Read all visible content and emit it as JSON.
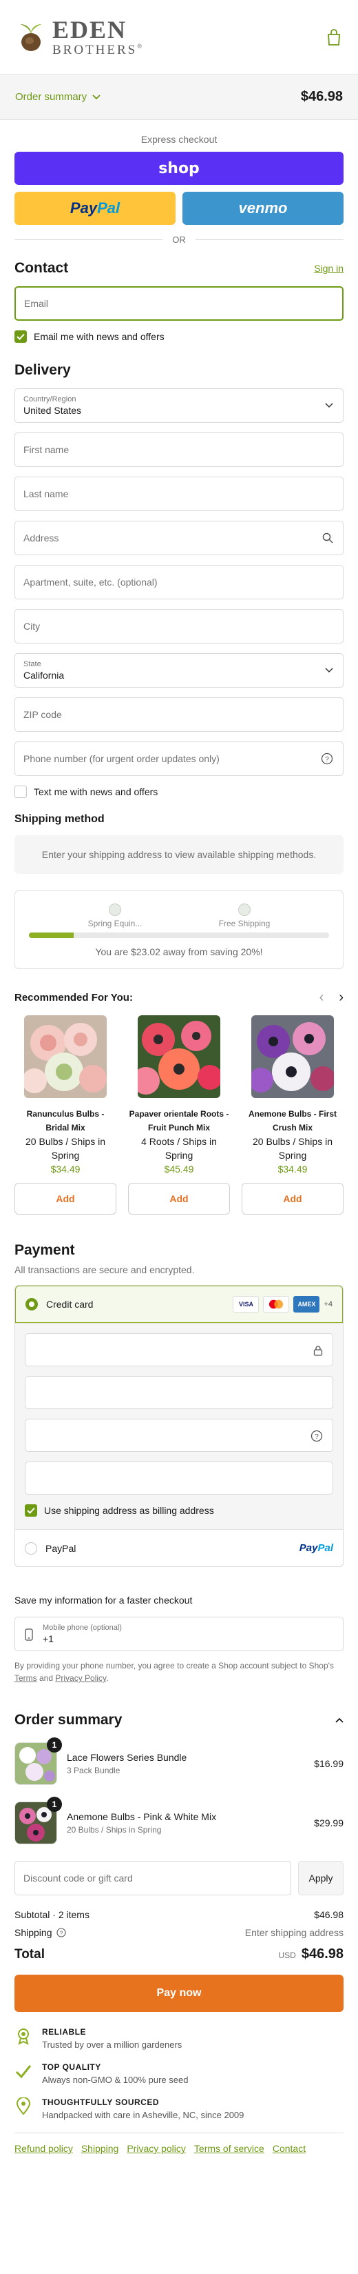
{
  "brand": {
    "line1": "EDEN",
    "line2": "BROTHERS",
    "mark": "®"
  },
  "summary_bar": {
    "toggle_label": "Order summary",
    "total": "$46.98"
  },
  "express": {
    "title": "Express checkout",
    "shop_label": "shop",
    "paypal_a": "Pay",
    "paypal_b": "Pal",
    "venmo_label": "venmo",
    "or_label": "OR"
  },
  "contact": {
    "heading": "Contact",
    "sign_in": "Sign in",
    "email_placeholder": "Email",
    "news_label": "Email me with news and offers",
    "news_checked": true
  },
  "delivery": {
    "heading": "Delivery",
    "country_label": "Country/Region",
    "country_value": "United States",
    "first_name": "First name",
    "last_name": "Last name",
    "address": "Address",
    "apartment": "Apartment, suite, etc. (optional)",
    "city": "City",
    "state_label": "State",
    "state_value": "California",
    "zip": "ZIP code",
    "phone": "Phone number (for urgent order updates only)",
    "sms_label": "Text me with news and offers"
  },
  "shipping_method": {
    "heading": "Shipping method",
    "note": "Enter your shipping address to view available shipping methods."
  },
  "progress": {
    "mark1": "Spring Equin...",
    "mark2": "Free Shipping",
    "fill_fraction": 0.15,
    "message": "You are $23.02 away from saving 20%!"
  },
  "recommended": {
    "heading": "Recommended For You:",
    "prev": "‹",
    "next": "›",
    "add_label": "Add",
    "items": [
      {
        "name": "Ranunculus Bulbs - Bridal Mix",
        "desc": "20 Bulbs / Ships in Spring",
        "price": "$34.49"
      },
      {
        "name": "Papaver orientale Roots - Fruit Punch Mix",
        "desc": "4 Roots / Ships in Spring",
        "price": "$45.49"
      },
      {
        "name": "Anemone Bulbs - First Crush Mix",
        "desc": "20 Bulbs / Ships in Spring",
        "price": "$34.49"
      }
    ]
  },
  "payment": {
    "heading": "Payment",
    "subtitle": "All transactions are secure and encrypted.",
    "credit_card": "Credit card",
    "card_visa": "VISA",
    "card_amex": "AMEX",
    "more_cards": "+4",
    "billing_label": "Use shipping address as billing address",
    "paypal_option": "PayPal",
    "paypal_logo_a": "Pay",
    "paypal_logo_b": "Pal"
  },
  "save_info": {
    "title": "Save my information for a faster checkout",
    "phone_label": "Mobile phone (optional)",
    "phone_value": "+1",
    "legal_a": "By providing your phone number, you agree to create a Shop account subject to Shop's ",
    "terms": "Terms",
    "legal_b": " and ",
    "privacy": "Privacy Policy",
    "legal_c": "."
  },
  "order_summary": {
    "heading": "Order summary",
    "items": [
      {
        "qty": "1",
        "title": "Lace Flowers Series Bundle",
        "sub": "3 Pack Bundle",
        "price": "$16.99"
      },
      {
        "qty": "1",
        "title": "Anemone Bulbs - Pink & White Mix",
        "sub": "20 Bulbs / Ships in Spring",
        "price": "$29.99"
      }
    ],
    "discount_placeholder": "Discount code or gift card",
    "apply": "Apply",
    "subtotal_label": "Subtotal · 2 items",
    "subtotal_value": "$46.98",
    "shipping_label": "Shipping",
    "shipping_value": "Enter shipping address",
    "total_label": "Total",
    "currency": "USD",
    "total_value": "$46.98",
    "pay_now": "Pay now"
  },
  "trust": [
    {
      "icon": "ribbon-award-icon",
      "title": "RELIABLE",
      "text": "Trusted by over a million gardeners"
    },
    {
      "icon": "checkmark-icon",
      "title": "TOP QUALITY",
      "text": "Always non-GMO & 100% pure seed"
    },
    {
      "icon": "location-pin-icon",
      "title": "THOUGHTFULLY SOURCED",
      "text": "Handpacked with care in Asheville, NC, since 2009"
    }
  ],
  "footer": [
    "Refund policy",
    "Shipping",
    "Privacy policy",
    "Terms of service",
    "Contact"
  ],
  "colors": {
    "accent_green": "#6f9a14",
    "shop_purple": "#5a31f4",
    "paypal_yellow": "#ffc439",
    "venmo_blue": "#3d95ce",
    "pay_now_orange": "#e8731f"
  }
}
